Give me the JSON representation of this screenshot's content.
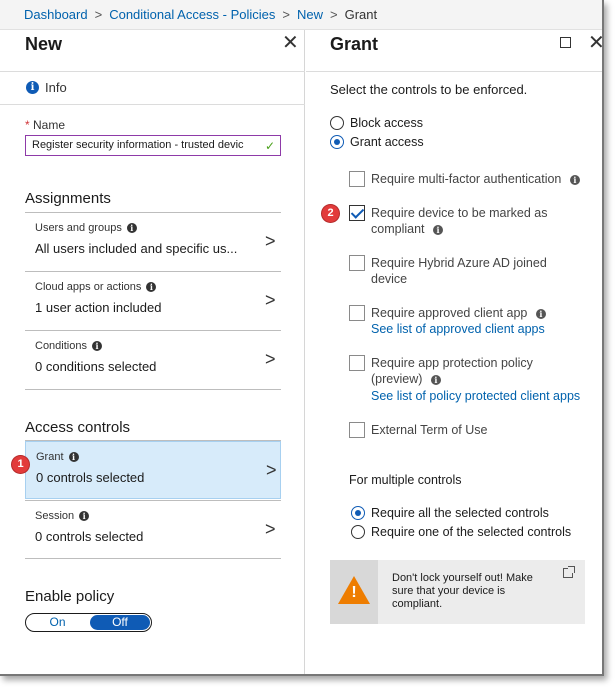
{
  "breadcrumb": {
    "items": [
      "Dashboard",
      "Conditional Access - Policies",
      "New"
    ],
    "current": "Grant"
  },
  "left_blade": {
    "title": "New",
    "info_label": "Info",
    "name_label": "Name",
    "name_value": "Register security information - trusted devic",
    "assignments_header": "Assignments",
    "assignments": [
      {
        "label": "Users and groups",
        "value": "All users included and specific us..."
      },
      {
        "label": "Cloud apps or actions",
        "value": "1 user action included"
      },
      {
        "label": "Conditions",
        "value": "0 conditions selected"
      }
    ],
    "access_controls_header": "Access controls",
    "access_controls": [
      {
        "label": "Grant",
        "value": "0 controls selected",
        "selected": true,
        "badge": "1"
      },
      {
        "label": "Session",
        "value": "0 controls selected"
      }
    ],
    "enable_policy_header": "Enable policy",
    "toggle": {
      "on": "On",
      "off": "Off",
      "selected": "Off"
    }
  },
  "right_blade": {
    "title": "Grant",
    "intro": "Select the controls to be enforced.",
    "access_options": [
      {
        "label": "Block access",
        "checked": false
      },
      {
        "label": "Grant access",
        "checked": true
      }
    ],
    "controls": [
      {
        "label": "Require multi-factor authentication",
        "checked": false
      },
      {
        "label": "Require device to be marked as compliant",
        "checked": true,
        "badge": "2"
      },
      {
        "label": "Require Hybrid Azure AD joined device",
        "checked": false
      },
      {
        "label": "Require approved client app",
        "checked": false,
        "link": "See list of approved client apps"
      },
      {
        "label": "Require app protection policy (preview)",
        "checked": false,
        "link": "See list of policy protected client apps"
      },
      {
        "label": "External Term of Use",
        "checked": false
      }
    ],
    "multiple_header": "For multiple controls",
    "multiple_options": [
      {
        "label": "Require all the selected controls",
        "checked": true
      },
      {
        "label": "Require one of the selected controls",
        "checked": false
      }
    ],
    "warning": "Don't lock yourself out! Make sure that your device is compliant."
  },
  "colors": {
    "accent": "#0f5bb5",
    "link": "#0062ad",
    "selected_bg": "#d7ebfa",
    "badge": "#e23b3b",
    "warning": "#ee7d00"
  }
}
